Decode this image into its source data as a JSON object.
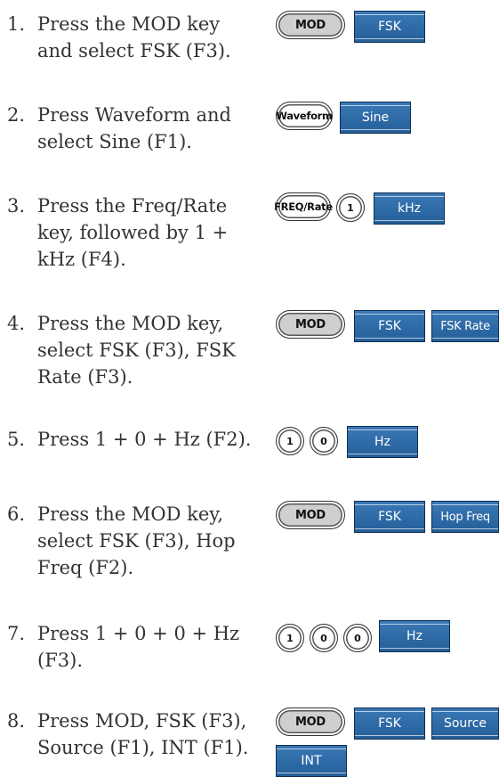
{
  "steps": [
    {
      "number": "1.",
      "lines": [
        "Press the MOD key",
        "and select FSK (F3)."
      ],
      "keys": [
        {
          "kind": "hardware",
          "label": "MOD",
          "icon": "mod-key"
        },
        {
          "kind": "soft",
          "label": "FSK"
        }
      ]
    },
    {
      "number": "2.",
      "lines": [
        "Press Waveform and",
        "select Sine (F1)."
      ],
      "keys": [
        {
          "kind": "hardware",
          "label": "Waveform",
          "icon": "waveform-key"
        },
        {
          "kind": "soft",
          "label": "Sine"
        }
      ]
    },
    {
      "number": "3.",
      "lines": [
        "Press the Freq/Rate",
        "key, followed by 1 +",
        "kHz (F4)."
      ],
      "keys": [
        {
          "kind": "hardware",
          "label": "FREQ/Rate",
          "icon": "freq-rate-key"
        },
        {
          "kind": "number",
          "label": "1"
        },
        {
          "kind": "soft",
          "label": "kHz"
        }
      ]
    },
    {
      "number": "4.",
      "lines": [
        "Press the MOD key,",
        "select FSK (F3), FSK",
        "Rate (F3)."
      ],
      "keys": [
        {
          "kind": "hardware",
          "label": "MOD",
          "icon": "mod-key"
        },
        {
          "kind": "soft",
          "label": "FSK"
        },
        {
          "kind": "soft",
          "label": "FSK Rate"
        }
      ]
    },
    {
      "number": "5.",
      "lines": [
        "Press 1 + 0 + Hz (F2)."
      ],
      "keys": [
        {
          "kind": "number",
          "label": "1"
        },
        {
          "kind": "number",
          "label": "0"
        },
        {
          "kind": "soft",
          "label": "Hz"
        }
      ]
    },
    {
      "number": "6.",
      "lines": [
        "Press the MOD key,",
        "select FSK (F3), Hop",
        "Freq (F2)."
      ],
      "keys": [
        {
          "kind": "hardware",
          "label": "MOD",
          "icon": "mod-key"
        },
        {
          "kind": "soft",
          "label": "FSK"
        },
        {
          "kind": "soft",
          "label": "Hop Freq"
        }
      ]
    },
    {
      "number": "7.",
      "lines": [
        "Press 1 + 0 + 0 + Hz",
        "(F3)."
      ],
      "keys": [
        {
          "kind": "number",
          "label": "1"
        },
        {
          "kind": "number",
          "label": "0"
        },
        {
          "kind": "number",
          "label": "0"
        },
        {
          "kind": "soft",
          "label": "Hz"
        }
      ]
    },
    {
      "number": "8.",
      "lines": [
        "Press MOD, FSK (F3),",
        "Source (F1), INT (F1)."
      ],
      "keys": [
        {
          "kind": "hardware",
          "label": "MOD",
          "icon": "mod-key"
        },
        {
          "kind": "soft",
          "label": "FSK"
        },
        {
          "kind": "soft",
          "label": "Source"
        },
        {
          "kind": "soft",
          "label": "INT"
        }
      ]
    }
  ],
  "colors": {
    "softkey_blue": "#2e6ba8",
    "hardware_key_gray": "#cfcfcf",
    "text": "#333333"
  }
}
